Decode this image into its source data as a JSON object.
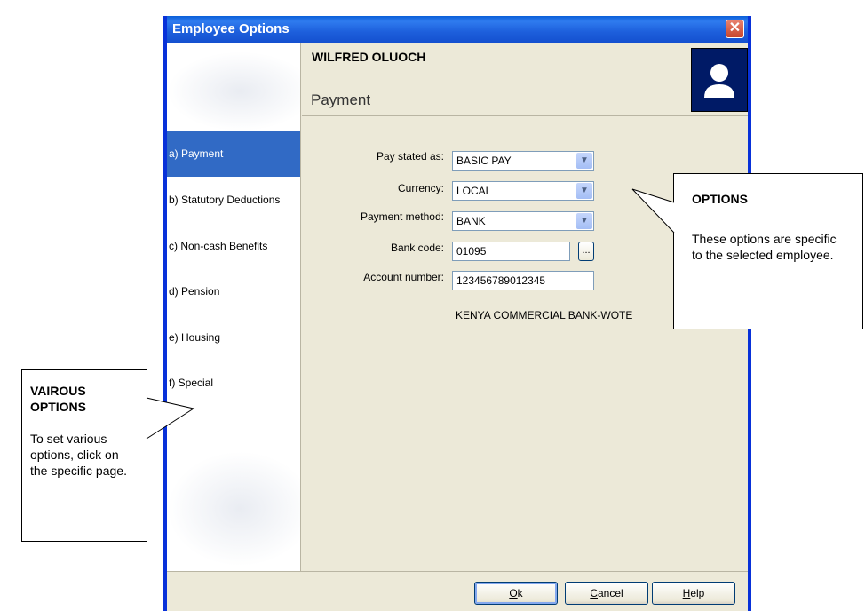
{
  "window": {
    "title": "Employee Options"
  },
  "employee": {
    "name": "WILFRED OLUOCH"
  },
  "section_title": "Payment",
  "nav": {
    "items": [
      {
        "label": "a) Payment",
        "active": true
      },
      {
        "label": "b) Statutory Deductions",
        "active": false
      },
      {
        "label": "c) Non-cash Benefits",
        "active": false
      },
      {
        "label": "d) Pension",
        "active": false
      },
      {
        "label": "e) Housing",
        "active": false
      },
      {
        "label": "f) Special",
        "active": false
      }
    ]
  },
  "form": {
    "pay_stated_as": {
      "label": "Pay stated as:",
      "value": "BASIC PAY"
    },
    "currency": {
      "label": "Currency:",
      "value": "LOCAL"
    },
    "payment_method": {
      "label": "Payment method:",
      "value": "BANK"
    },
    "bank_code": {
      "label": "Bank code:",
      "value": "01095",
      "browse": "..."
    },
    "account_number": {
      "label": "Account number:",
      "value": "123456789012345"
    },
    "bank_name": "KENYA COMMERCIAL BANK-WOTE"
  },
  "buttons": {
    "ok": {
      "accel": "O",
      "rest": "k"
    },
    "cancel": {
      "accel": "C",
      "rest": "ancel"
    },
    "help": {
      "accel": "H",
      "rest": "elp"
    }
  },
  "callouts": {
    "options": {
      "title": "OPTIONS",
      "body": "These options are specific to the selected employee."
    },
    "various": {
      "title": "VAIROUS OPTIONS",
      "body": "To set various options, click on the specific page."
    }
  },
  "colors": {
    "titlebar": "#0a5fd8",
    "selected_nav": "#316ac5",
    "window_bg": "#ece9d8",
    "avatar_bg": "#001a66"
  },
  "icons": {
    "close": "close-icon",
    "avatar": "user-silhouette-icon",
    "dropdown": "chevron-down-icon"
  }
}
